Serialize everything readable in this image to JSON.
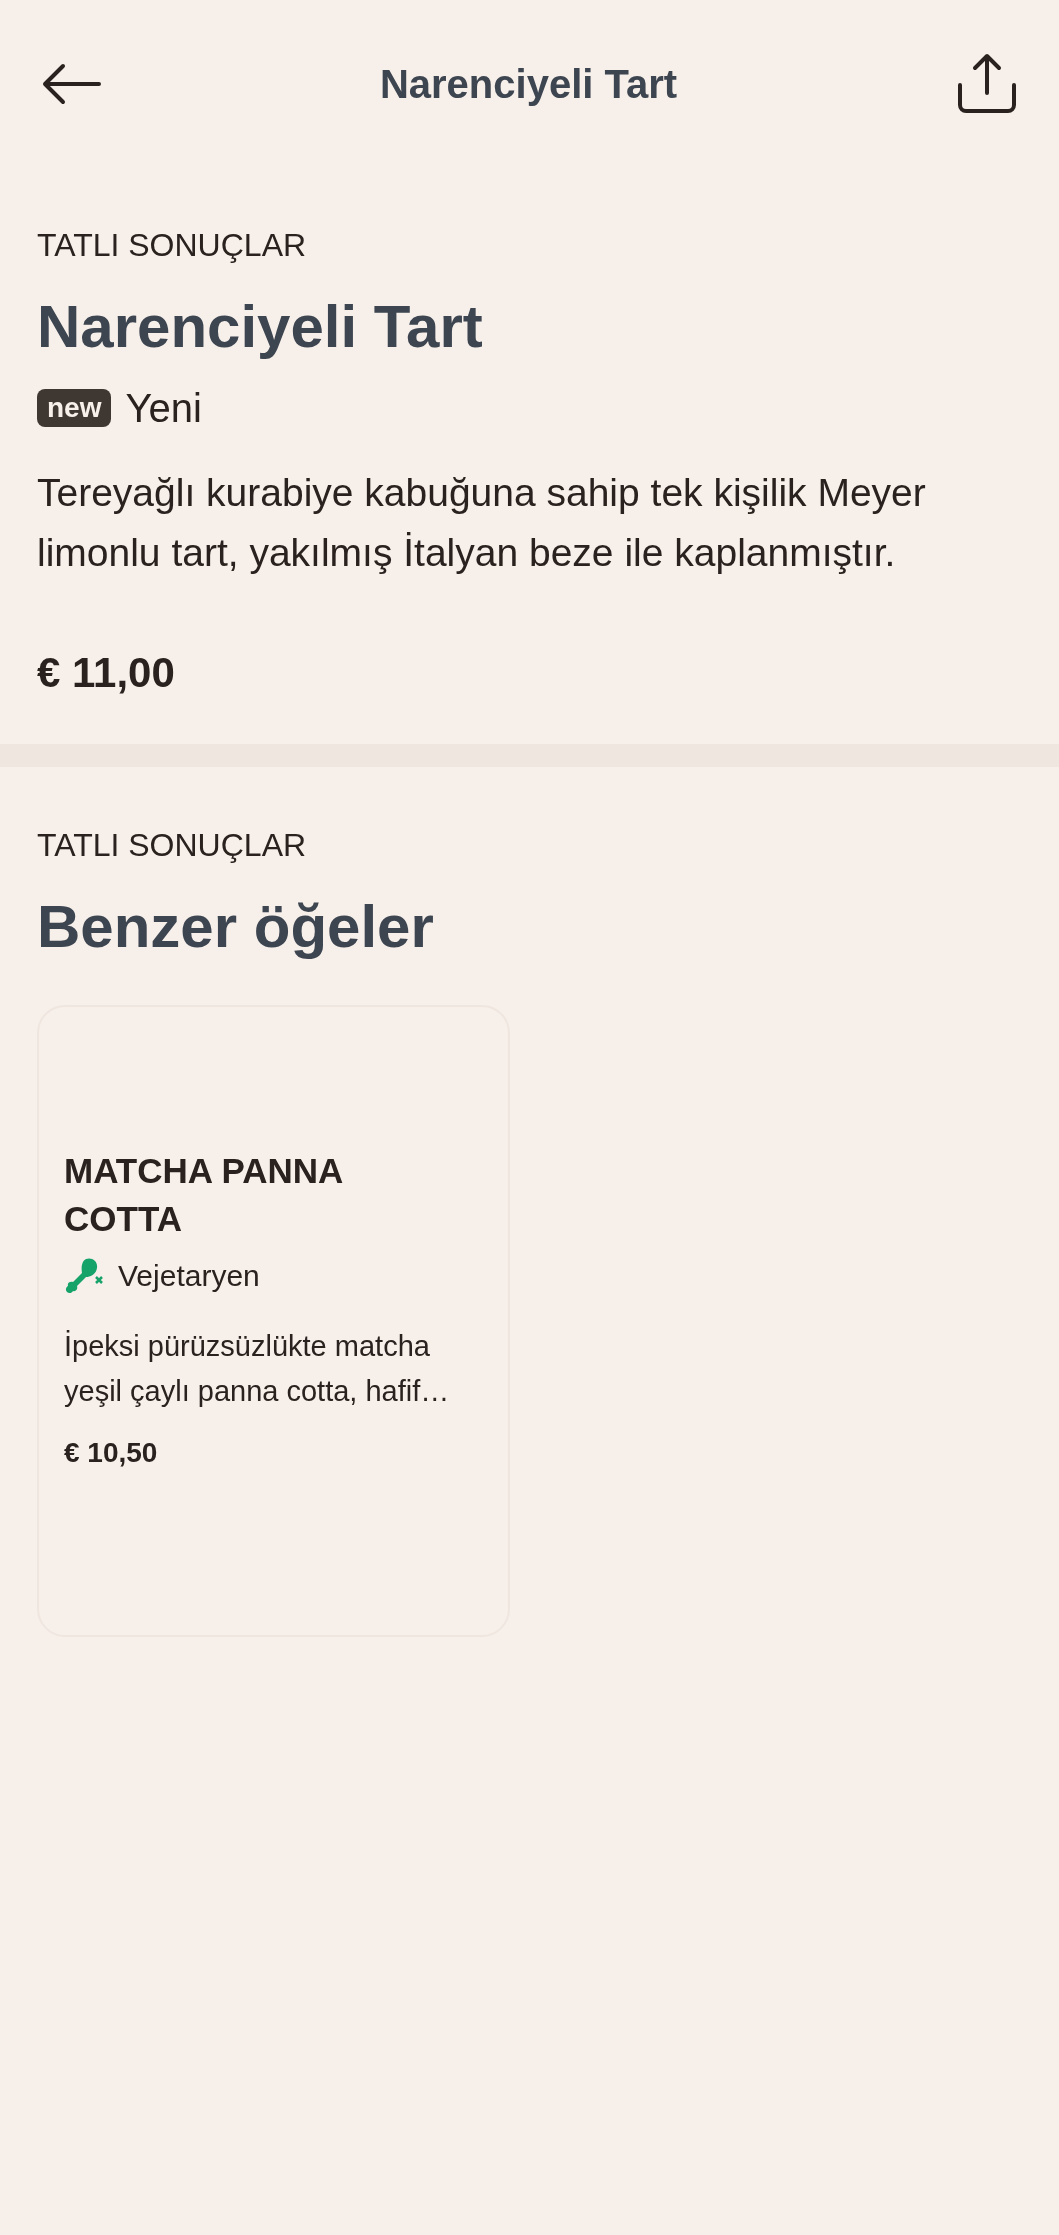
{
  "header": {
    "title": "Narenciyeli Tart"
  },
  "product": {
    "category": "TATLI SONUÇLAR",
    "name": "Narenciyeli Tart",
    "badge": "new",
    "badge_label": "Yeni",
    "description": "Tereyağlı kurabiye kabuğuna sahip tek kişilik Meyer limonlu tart, yakılmış İtalyan beze ile kaplanmıştır.",
    "price": "€ 11,00"
  },
  "similar": {
    "category": "TATLI SONUÇLAR",
    "title": "Benzer öğeler",
    "items": [
      {
        "name": "MATCHA PANNA COTTA",
        "diet": "Vejetaryen",
        "description": "İpeksi pürüzsüzlükte matcha yeşil çaylı panna cotta, hafif…",
        "price": "€ 10,50"
      }
    ]
  }
}
